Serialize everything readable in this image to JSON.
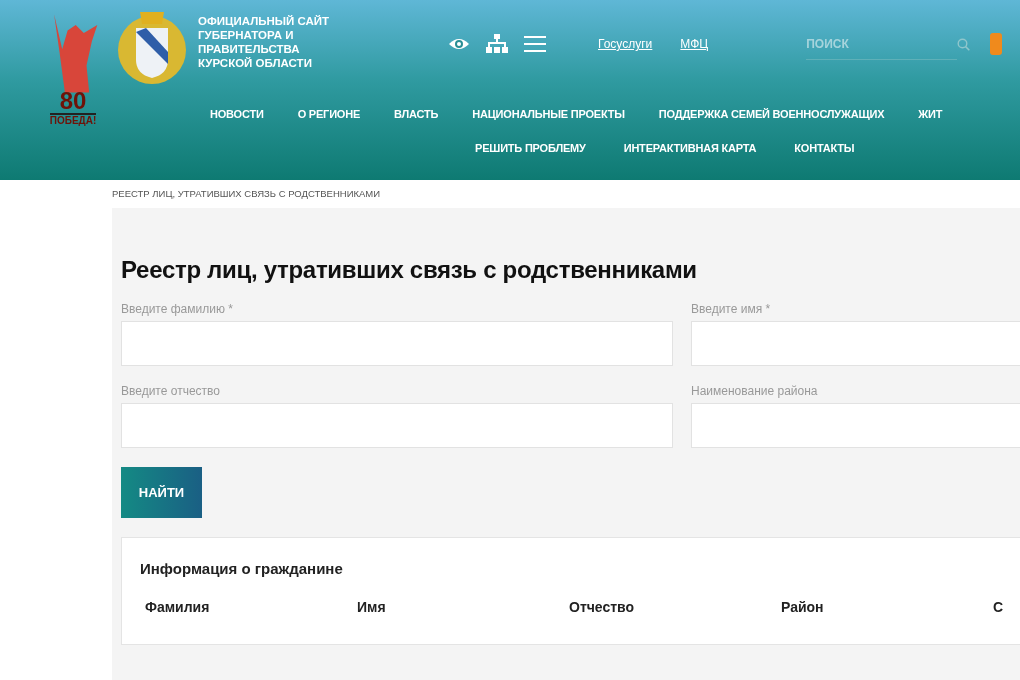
{
  "header": {
    "victory_logo": {
      "number": "80",
      "caption": "ПОБЕДА!"
    },
    "site_title": [
      "ОФИЦИАЛЬНЫЙ САЙТ",
      "ГУБЕРНАТОРА И",
      "ПРАВИТЕЛЬСТВА",
      "КУРСКОЙ ОБЛАСТИ"
    ],
    "links": [
      "Госуслуги",
      "МФЦ"
    ],
    "search": {
      "placeholder": "ПОИСК"
    },
    "nav_rows": [
      [
        "НОВОСТИ",
        "О РЕГИОНЕ",
        "ВЛАСТЬ",
        "НАЦИОНАЛЬНЫЕ ПРОЕКТЫ",
        "ПОДДЕРЖКА СЕМЕЙ ВОЕННОСЛУЖАЩИХ",
        "ЖИТ"
      ],
      [
        "РЕШИТЬ ПРОБЛЕМУ",
        "ИНТЕРАКТИВНАЯ КАРТА",
        "КОНТАКТЫ"
      ]
    ]
  },
  "breadcrumb": "РЕЕСТР ЛИЦ, УТРАТИВШИХ СВЯЗЬ С РОДСТВЕННИКАМИ",
  "page_title": "Реестр лиц, утративших связь с родственниками",
  "fields": [
    {
      "label": "Введите фамилию *"
    },
    {
      "label": "Введите имя *"
    },
    {
      "label": "Введите отчество"
    },
    {
      "label": "Наименование района"
    }
  ],
  "search_button": "НАЙТИ",
  "result": {
    "title": "Информация о гражданине",
    "columns": [
      "Фамилия",
      "Имя",
      "Отчество",
      "Район",
      "С"
    ]
  }
}
